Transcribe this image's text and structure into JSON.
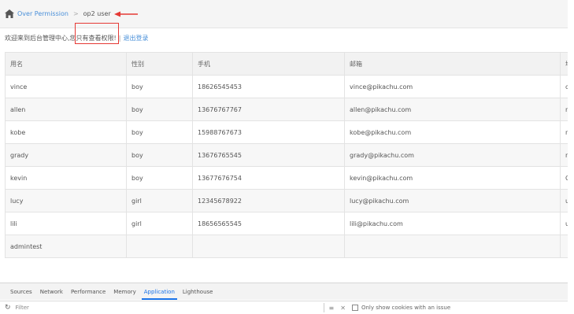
{
  "breadcrumb": {
    "parent": "Over Permission",
    "separator": ">",
    "current": "op2 user"
  },
  "welcome": {
    "text_before": "欢迎来到后台管理中心,",
    "text_highlight": "您只有查看权限!",
    "pipe": "|",
    "logout": "退出登录"
  },
  "table": {
    "headers": [
      "用名",
      "性别",
      "手机",
      "邮箱",
      "地"
    ],
    "rows": [
      [
        "vince",
        "boy",
        "18626545453",
        "vince@pikachu.com",
        "ch"
      ],
      [
        "allen",
        "boy",
        "13676767767",
        "allen@pikachu.com",
        "nb"
      ],
      [
        "kobe",
        "boy",
        "15988767673",
        "kobe@pikachu.com",
        "nb"
      ],
      [
        "grady",
        "boy",
        "13676765545",
        "grady@pikachu.com",
        "nb"
      ],
      [
        "kevin",
        "boy",
        "13677676754",
        "kevin@pikachu.com",
        "O"
      ],
      [
        "lucy",
        "girl",
        "12345678922",
        "lucy@pikachu.com",
        "us"
      ],
      [
        "lili",
        "girl",
        "18656565545",
        "lili@pikachu.com",
        "us"
      ],
      [
        "admintest",
        "",
        "",
        "",
        ""
      ]
    ]
  },
  "devtools": {
    "tabs": [
      "Sources",
      "Network",
      "Performance",
      "Memory",
      "Application",
      "Lighthouse"
    ],
    "active_tab": "Application",
    "filter_placeholder": "Filter",
    "only_issues_label": "Only show cookies with an issue"
  },
  "colors": {
    "link": "#4a90d9",
    "highlight_red": "#e53935",
    "active_tab": "#1a73e8"
  }
}
